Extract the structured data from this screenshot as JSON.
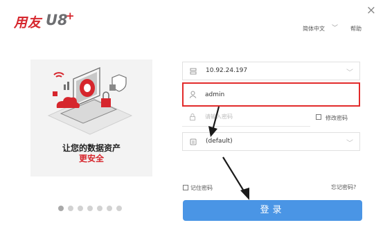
{
  "brand": {
    "name_cn": "用友",
    "product": "U8",
    "plus": "+"
  },
  "window": {
    "close_label": "×"
  },
  "header": {
    "language": "简体中文",
    "help": "帮助"
  },
  "promo": {
    "line1": "让您的数据资产",
    "line2": "更安全"
  },
  "carousel": {
    "count": 7,
    "active_index": 0
  },
  "form": {
    "server": "10.92.24.197",
    "username": "admin",
    "password_placeholder": "请输入密码",
    "change_password": "修改密码",
    "account_set": "(default)",
    "remember_password": "记住密码",
    "forgot_password": "忘记密码?",
    "login": "登录"
  },
  "colors": {
    "brand_red": "#d6262d",
    "login_blue": "#4a95e5",
    "highlight_red": "#e22a2a"
  }
}
